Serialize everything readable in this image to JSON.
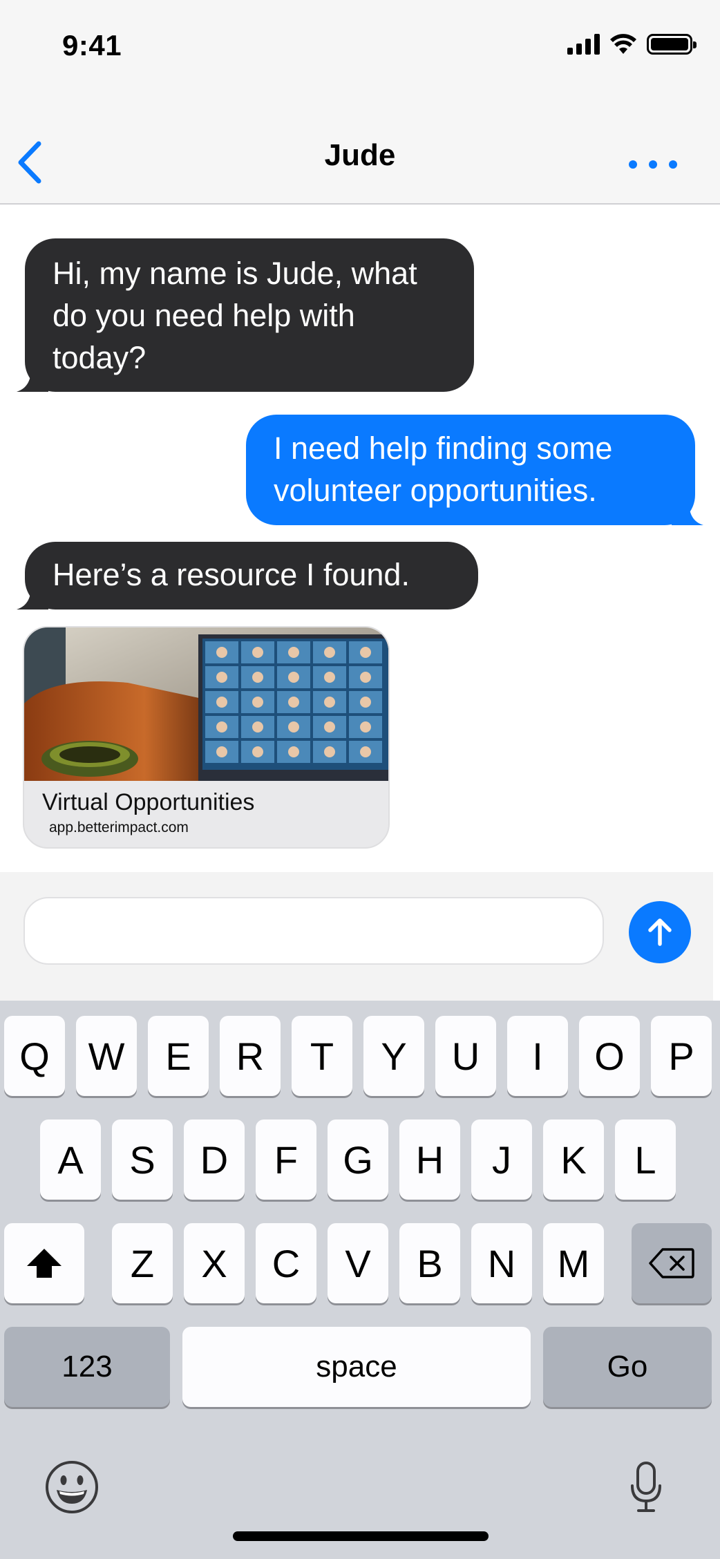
{
  "status_bar": {
    "time": "9:41"
  },
  "nav": {
    "title": "Jude"
  },
  "messages": {
    "m1": "Hi, my name is Jude, what do you need help with today?",
    "m2": "I need help finding some volunteer opportunities.",
    "m3": "Here’s a resource I found."
  },
  "link_preview": {
    "title": "Virtual Opportunities",
    "domain": "app.betterimpact.com"
  },
  "input": {
    "value": "",
    "placeholder": ""
  },
  "keyboard": {
    "row1": [
      "Q",
      "W",
      "E",
      "R",
      "T",
      "Y",
      "U",
      "I",
      "O",
      "P"
    ],
    "row2": [
      "A",
      "S",
      "D",
      "F",
      "G",
      "H",
      "J",
      "K",
      "L"
    ],
    "row3": [
      "Z",
      "X",
      "C",
      "V",
      "B",
      "N",
      "M"
    ],
    "numbers_label": "123",
    "space_label": "space",
    "go_label": "Go"
  },
  "colors": {
    "accent": "#0a7aff",
    "incoming_bubble": "#2c2c2e",
    "keyboard_bg": "#d1d4da"
  },
  "icons": [
    "back-chevron-icon",
    "more-dots-icon",
    "send-arrow-icon",
    "shift-icon",
    "delete-icon",
    "emoji-icon",
    "microphone-icon",
    "signal-icon",
    "wifi-icon",
    "battery-icon"
  ]
}
